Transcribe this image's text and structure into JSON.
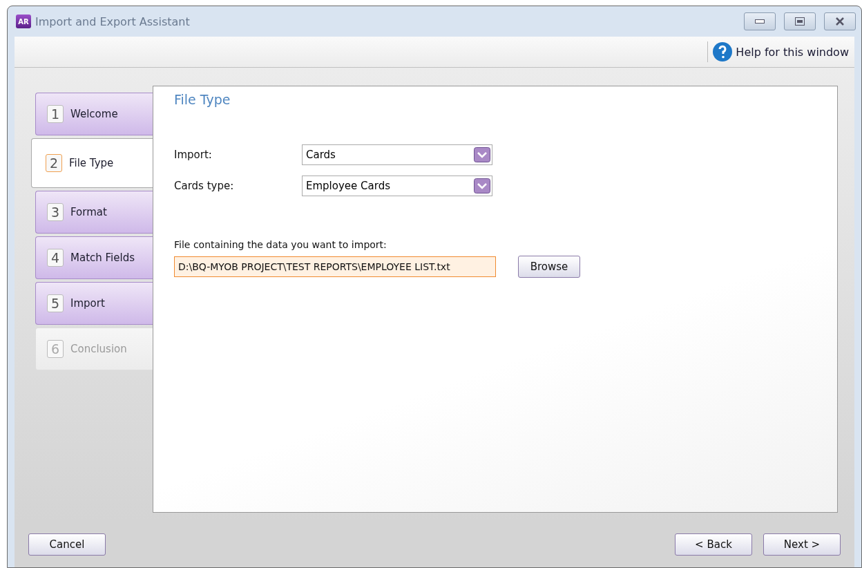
{
  "window": {
    "title": "Import and Export Assistant",
    "app_badge": "AR"
  },
  "toolbar": {
    "help": "Help for this window"
  },
  "steps": [
    {
      "number": "1",
      "label": "Welcome",
      "selected": false,
      "disabled": false
    },
    {
      "number": "2",
      "label": "File Type",
      "selected": true,
      "disabled": false
    },
    {
      "number": "3",
      "label": "Format",
      "selected": false,
      "disabled": false
    },
    {
      "number": "4",
      "label": "Match Fields",
      "selected": false,
      "disabled": false
    },
    {
      "number": "5",
      "label": "Import",
      "selected": false,
      "disabled": false
    },
    {
      "number": "6",
      "label": "Conclusion",
      "selected": false,
      "disabled": true
    }
  ],
  "panel": {
    "title": "File Type",
    "fields": [
      {
        "label": "Import:",
        "value": "Cards"
      },
      {
        "label": "Cards type:",
        "value": "Employee Cards"
      }
    ],
    "file_label": "File containing the data you want to import:",
    "file_path": "D:\\BQ-MYOB PROJECT\\TEST REPORTS\\EMPLOYEE LIST.txt",
    "browse": "Browse"
  },
  "buttons": {
    "cancel": "Cancel",
    "back": "< Back",
    "next": "Next >"
  }
}
